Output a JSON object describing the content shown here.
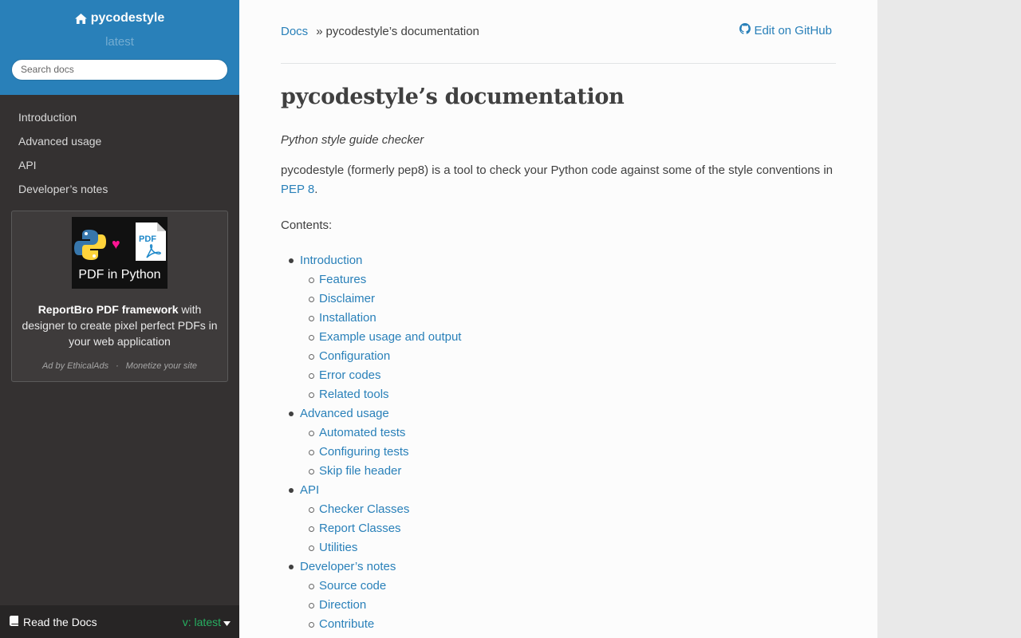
{
  "sidebar": {
    "project_name": "pycodestyle",
    "version": "latest",
    "search_placeholder": "Search docs",
    "nav": [
      "Introduction",
      "Advanced usage",
      "API",
      "Developer’s notes"
    ],
    "ad": {
      "image_caption": "PDF in Python",
      "image_badge": "PDF",
      "headline": "ReportBro PDF framework",
      "body": " with designer to create pixel perfect PDFs in your web application",
      "footer_left": "Ad by EthicalAds",
      "footer_sep": "·",
      "footer_right": "Monetize your site"
    },
    "footer": {
      "left": "Read the Docs",
      "right": "v: latest"
    }
  },
  "breadcrumbs": {
    "home": "Docs",
    "separator": "»",
    "current": "pycodestyle’s documentation",
    "edit": "Edit on GitHub"
  },
  "main": {
    "title": "pycodestyle’s documentation",
    "tagline": "Python style guide checker",
    "intro_text": "pycodestyle (formerly pep8) is a tool to check your Python code against some of the style conventions in ",
    "intro_link": "PEP 8",
    "intro_end": ".",
    "contents_label": "Contents:",
    "toc": [
      {
        "label": "Introduction",
        "children": [
          "Features",
          "Disclaimer",
          "Installation",
          "Example usage and output",
          "Configuration",
          "Error codes",
          "Related tools"
        ]
      },
      {
        "label": "Advanced usage",
        "children": [
          "Automated tests",
          "Configuring tests",
          "Skip file header"
        ]
      },
      {
        "label": "API",
        "children": [
          "Checker Classes",
          "Report Classes",
          "Utilities"
        ]
      },
      {
        "label": "Developer’s notes",
        "children": [
          "Source code",
          "Direction",
          "Contribute"
        ]
      }
    ]
  },
  "colors": {
    "sidebar_header": "#2980b9",
    "sidebar_bg": "#343131",
    "link": "#2980b9",
    "version_accent": "#27ae60",
    "ad_heart": "#ff1493"
  }
}
